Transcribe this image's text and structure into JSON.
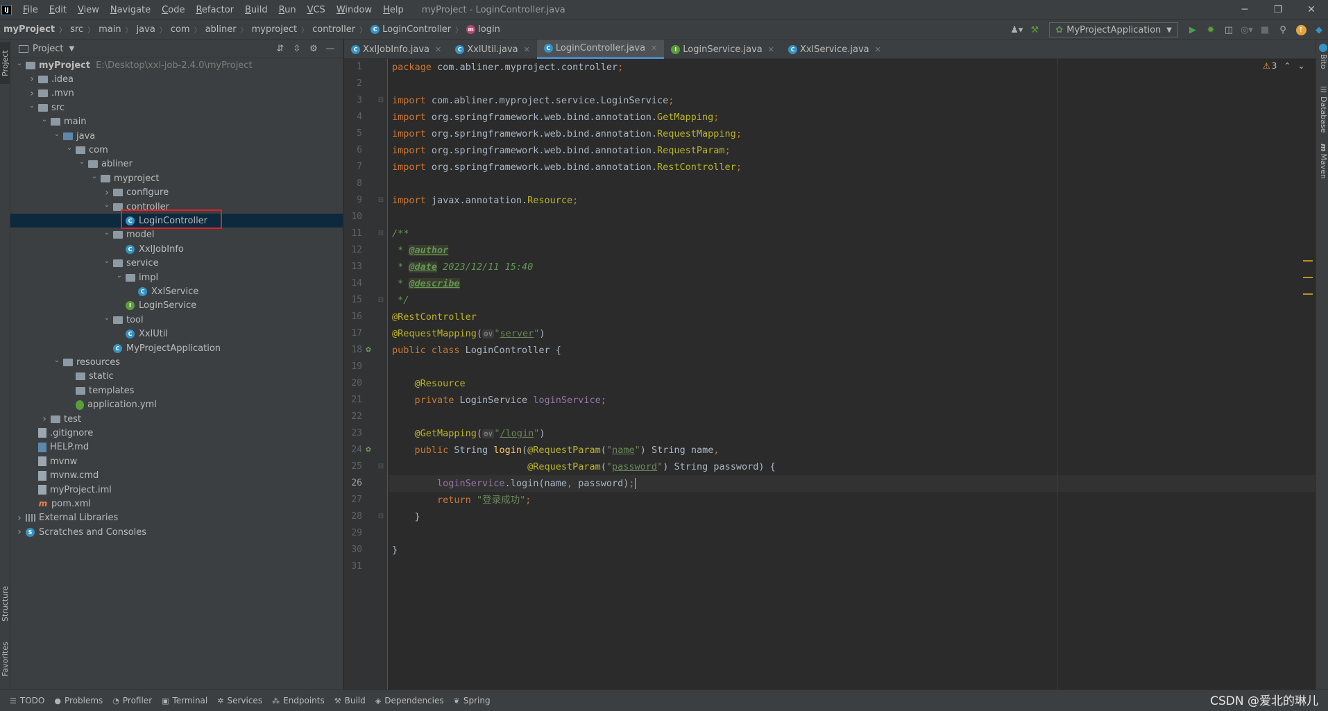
{
  "menubar": {
    "logo": "IJ",
    "items": [
      {
        "label": "File",
        "mn": "F",
        "rest": "ile"
      },
      {
        "label": "Edit",
        "mn": "E",
        "rest": "dit"
      },
      {
        "label": "View",
        "mn": "V",
        "rest": "iew"
      },
      {
        "label": "Navigate",
        "mn": "N",
        "rest": "avigate"
      },
      {
        "label": "Code",
        "mn": "C",
        "rest": "ode"
      },
      {
        "label": "Refactor",
        "mn": "R",
        "rest": "efactor"
      },
      {
        "label": "Build",
        "mn": "B",
        "rest": "uild"
      },
      {
        "label": "Run",
        "mn": "R",
        "rest": "un"
      },
      {
        "label": "VCS",
        "mn": "V",
        "rest": "CS"
      },
      {
        "label": "Window",
        "mn": "W",
        "rest": "indow"
      },
      {
        "label": "Help",
        "mn": "H",
        "rest": "elp"
      }
    ],
    "window_title": "myProject - LoginController.java",
    "minimize": "─",
    "restore": "❐",
    "close": "✕"
  },
  "breadcrumb": {
    "items": [
      "myProject",
      "src",
      "main",
      "java",
      "com",
      "abliner",
      "myproject",
      "controller"
    ],
    "class_name": "LoginController",
    "method_name": "login"
  },
  "toolbar": {
    "run_config": "MyProjectApplication"
  },
  "project_panel": {
    "title": "Project",
    "tree": [
      {
        "label": "myProject",
        "path": "E:\\Desktop\\xxl-job-2.4.0\\myProject",
        "depth": 0,
        "arrow": "open",
        "icon": "folder",
        "bold": true
      },
      {
        "label": ".idea",
        "depth": 1,
        "arrow": "closed",
        "icon": "folder"
      },
      {
        "label": ".mvn",
        "depth": 1,
        "arrow": "closed",
        "icon": "folder"
      },
      {
        "label": "src",
        "depth": 1,
        "arrow": "open",
        "icon": "folder"
      },
      {
        "label": "main",
        "depth": 2,
        "arrow": "open",
        "icon": "folder"
      },
      {
        "label": "java",
        "depth": 3,
        "arrow": "open",
        "icon": "folder-blue"
      },
      {
        "label": "com",
        "depth": 4,
        "arrow": "open",
        "icon": "folder"
      },
      {
        "label": "abliner",
        "depth": 5,
        "arrow": "open",
        "icon": "folder"
      },
      {
        "label": "myproject",
        "depth": 6,
        "arrow": "open",
        "icon": "folder"
      },
      {
        "label": "configure",
        "depth": 7,
        "arrow": "closed",
        "icon": "folder"
      },
      {
        "label": "controller",
        "depth": 7,
        "arrow": "open",
        "icon": "folder"
      },
      {
        "label": "LoginController",
        "depth": 8,
        "arrow": "none",
        "icon": "class",
        "selected": true
      },
      {
        "label": "model",
        "depth": 7,
        "arrow": "open",
        "icon": "folder"
      },
      {
        "label": "XxlJobInfo",
        "depth": 8,
        "arrow": "none",
        "icon": "class"
      },
      {
        "label": "service",
        "depth": 7,
        "arrow": "open",
        "icon": "folder"
      },
      {
        "label": "impl",
        "depth": 8,
        "arrow": "open",
        "icon": "folder"
      },
      {
        "label": "XxlService",
        "depth": 9,
        "arrow": "none",
        "icon": "class"
      },
      {
        "label": "LoginService",
        "depth": 8,
        "arrow": "none",
        "icon": "interface"
      },
      {
        "label": "tool",
        "depth": 7,
        "arrow": "open",
        "icon": "folder"
      },
      {
        "label": "XxlUtil",
        "depth": 8,
        "arrow": "none",
        "icon": "class"
      },
      {
        "label": "MyProjectApplication",
        "depth": 7,
        "arrow": "none",
        "icon": "class"
      },
      {
        "label": "resources",
        "depth": 3,
        "arrow": "open",
        "icon": "folder-res"
      },
      {
        "label": "static",
        "depth": 4,
        "arrow": "none",
        "icon": "folder"
      },
      {
        "label": "templates",
        "depth": 4,
        "arrow": "none",
        "icon": "folder"
      },
      {
        "label": "application.yml",
        "depth": 4,
        "arrow": "none",
        "icon": "yml"
      },
      {
        "label": "test",
        "depth": 2,
        "arrow": "closed",
        "icon": "folder"
      },
      {
        "label": ".gitignore",
        "depth": 1,
        "arrow": "none",
        "icon": "file"
      },
      {
        "label": "HELP.md",
        "depth": 1,
        "arrow": "none",
        "icon": "md"
      },
      {
        "label": "mvnw",
        "depth": 1,
        "arrow": "none",
        "icon": "file"
      },
      {
        "label": "mvnw.cmd",
        "depth": 1,
        "arrow": "none",
        "icon": "file"
      },
      {
        "label": "myProject.iml",
        "depth": 1,
        "arrow": "none",
        "icon": "file"
      },
      {
        "label": "pom.xml",
        "depth": 1,
        "arrow": "none",
        "icon": "xml"
      },
      {
        "label": "External Libraries",
        "depth": 0,
        "arrow": "closed",
        "icon": "ext"
      },
      {
        "label": "Scratches and Consoles",
        "depth": 0,
        "arrow": "closed",
        "icon": "scratch"
      }
    ]
  },
  "editor": {
    "tabs": [
      {
        "label": "XxlJobInfo.java",
        "icon": "class",
        "active": false
      },
      {
        "label": "XxlUtil.java",
        "icon": "class",
        "active": false
      },
      {
        "label": "LoginController.java",
        "icon": "class",
        "active": true
      },
      {
        "label": "LoginService.java",
        "icon": "interface",
        "active": false
      },
      {
        "label": "XxlService.java",
        "icon": "class",
        "active": false
      }
    ],
    "current_line": 26,
    "warning_count": "3",
    "lines": [
      {
        "n": "1",
        "t": [
          [
            "kw",
            "package "
          ],
          [
            "",
            "com.abliner.myproject.controller"
          ],
          [
            "kw",
            ";"
          ]
        ]
      },
      {
        "n": "2",
        "t": []
      },
      {
        "n": "3",
        "t": [
          [
            "kw",
            "import "
          ],
          [
            "",
            "com.abliner.myproject.service.LoginService"
          ],
          [
            "kw",
            ";"
          ]
        ]
      },
      {
        "n": "4",
        "t": [
          [
            "kw",
            "import "
          ],
          [
            "",
            "org.springframework.web.bind.annotation."
          ],
          [
            "an",
            "GetMapping"
          ],
          [
            "kw",
            ";"
          ]
        ]
      },
      {
        "n": "5",
        "t": [
          [
            "kw",
            "import "
          ],
          [
            "",
            "org.springframework.web.bind.annotation."
          ],
          [
            "an",
            "RequestMapping"
          ],
          [
            "kw",
            ";"
          ]
        ]
      },
      {
        "n": "6",
        "t": [
          [
            "kw",
            "import "
          ],
          [
            "",
            "org.springframework.web.bind.annotation."
          ],
          [
            "an",
            "RequestParam"
          ],
          [
            "kw",
            ";"
          ]
        ]
      },
      {
        "n": "7",
        "t": [
          [
            "kw",
            "import "
          ],
          [
            "",
            "org.springframework.web.bind.annotation."
          ],
          [
            "an",
            "RestController"
          ],
          [
            "kw",
            ";"
          ]
        ]
      },
      {
        "n": "8",
        "t": []
      },
      {
        "n": "9",
        "t": [
          [
            "kw",
            "import "
          ],
          [
            "",
            "javax.annotation."
          ],
          [
            "an",
            "Resource"
          ],
          [
            "kw",
            ";"
          ]
        ]
      },
      {
        "n": "10",
        "t": []
      },
      {
        "n": "11",
        "t": [
          [
            "cm",
            "/**"
          ]
        ]
      },
      {
        "n": "12",
        "t": [
          [
            "cm",
            " * "
          ],
          [
            "dt",
            "@author"
          ]
        ]
      },
      {
        "n": "13",
        "t": [
          [
            "cm",
            " * "
          ],
          [
            "dt",
            "@date"
          ],
          [
            "cm",
            " 2023/12/11 15:40"
          ]
        ]
      },
      {
        "n": "14",
        "t": [
          [
            "cm",
            " * "
          ],
          [
            "dt",
            "@describe"
          ]
        ]
      },
      {
        "n": "15",
        "t": [
          [
            "cm",
            " */"
          ]
        ]
      },
      {
        "n": "16",
        "t": [
          [
            "an",
            "@RestController"
          ]
        ]
      },
      {
        "n": "17",
        "t": [
          [
            "an",
            "@RequestMapping"
          ],
          [
            "",
            "("
          ],
          [
            "glyph",
            "⊕∨"
          ],
          [
            "st",
            "\""
          ],
          [
            "st ul",
            "server"
          ],
          [
            "st",
            "\""
          ],
          [
            "",
            ")"
          ]
        ]
      },
      {
        "n": "18",
        "t": [
          [
            "kw",
            "public class "
          ],
          [
            "",
            "LoginController {"
          ]
        ]
      },
      {
        "n": "19",
        "t": []
      },
      {
        "n": "20",
        "t": [
          [
            "",
            "    "
          ],
          [
            "an",
            "@Resource"
          ]
        ]
      },
      {
        "n": "21",
        "t": [
          [
            "",
            "    "
          ],
          [
            "kw",
            "private "
          ],
          [
            "",
            "LoginService "
          ],
          [
            "fl",
            "loginService"
          ],
          [
            "kw",
            ";"
          ]
        ]
      },
      {
        "n": "22",
        "t": []
      },
      {
        "n": "23",
        "t": [
          [
            "",
            "    "
          ],
          [
            "an",
            "@GetMapping"
          ],
          [
            "",
            "("
          ],
          [
            "glyph",
            "⊕∨"
          ],
          [
            "st",
            "\""
          ],
          [
            "st ul",
            "/login"
          ],
          [
            "st",
            "\""
          ],
          [
            "",
            ")"
          ]
        ]
      },
      {
        "n": "24",
        "t": [
          [
            "",
            "    "
          ],
          [
            "kw",
            "public "
          ],
          [
            "",
            "String "
          ],
          [
            "mt",
            "login"
          ],
          [
            "",
            "("
          ],
          [
            "an",
            "@RequestParam"
          ],
          [
            "",
            "("
          ],
          [
            "st",
            "\""
          ],
          [
            "st ul",
            "name"
          ],
          [
            "st",
            "\""
          ],
          [
            "",
            ") String name"
          ],
          [
            "kw",
            ","
          ]
        ]
      },
      {
        "n": "25",
        "t": [
          [
            "",
            "                        "
          ],
          [
            "an",
            "@RequestParam"
          ],
          [
            "",
            "("
          ],
          [
            "st",
            "\""
          ],
          [
            "st ul",
            "password"
          ],
          [
            "st",
            "\""
          ],
          [
            "",
            ") String password) {"
          ]
        ]
      },
      {
        "n": "26",
        "t": [
          [
            "",
            "        "
          ],
          [
            "fl",
            "loginService"
          ],
          [
            "",
            ".login(name"
          ],
          [
            "kw",
            ", "
          ],
          [
            "",
            "password)"
          ],
          [
            "kw",
            ";"
          ],
          [
            "caret",
            ""
          ]
        ]
      },
      {
        "n": "27",
        "t": [
          [
            "",
            "        "
          ],
          [
            "kw",
            "return "
          ],
          [
            "st",
            "\"登录成功\""
          ],
          [
            "kw",
            ";"
          ]
        ]
      },
      {
        "n": "28",
        "t": [
          [
            "",
            "    }"
          ]
        ]
      },
      {
        "n": "29",
        "t": []
      },
      {
        "n": "30",
        "t": [
          [
            "",
            "}"
          ]
        ]
      },
      {
        "n": "31",
        "t": []
      }
    ]
  },
  "left_strip": {
    "project": "Project",
    "structure": "Structure",
    "favorites": "Favorites"
  },
  "right_strip": {
    "bito": "Bito",
    "database": "Database",
    "maven": "Maven"
  },
  "bottom_tabs": [
    {
      "label": "TODO",
      "icon": "☰"
    },
    {
      "label": "Problems",
      "icon": "●"
    },
    {
      "label": "Profiler",
      "icon": "◔"
    },
    {
      "label": "Terminal",
      "icon": "▣"
    },
    {
      "label": "Services",
      "icon": "✲"
    },
    {
      "label": "Endpoints",
      "icon": "⁂"
    },
    {
      "label": "Build",
      "icon": "⚒"
    },
    {
      "label": "Dependencies",
      "icon": "◈"
    },
    {
      "label": "Spring",
      "icon": "❦"
    }
  ],
  "watermark": "CSDN @爱北的琳儿"
}
